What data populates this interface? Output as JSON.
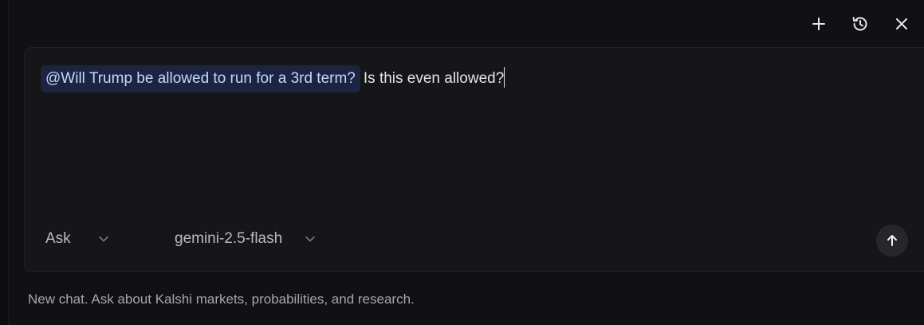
{
  "header": {
    "actions": [
      {
        "icon": "plus-icon"
      },
      {
        "icon": "history-icon"
      },
      {
        "icon": "close-icon"
      }
    ]
  },
  "composer": {
    "mention": "@Will Trump be allowed to run for a 3rd term?",
    "text": "Is this even allowed?",
    "mode_select": {
      "value": "Ask"
    },
    "model_select": {
      "value": "gemini-2.5-flash"
    },
    "send_icon": "arrow-up-icon",
    "mention_color": "#1b2440"
  },
  "footer": {
    "hint": "New chat. Ask about Kalshi markets, probabilities, and research."
  }
}
